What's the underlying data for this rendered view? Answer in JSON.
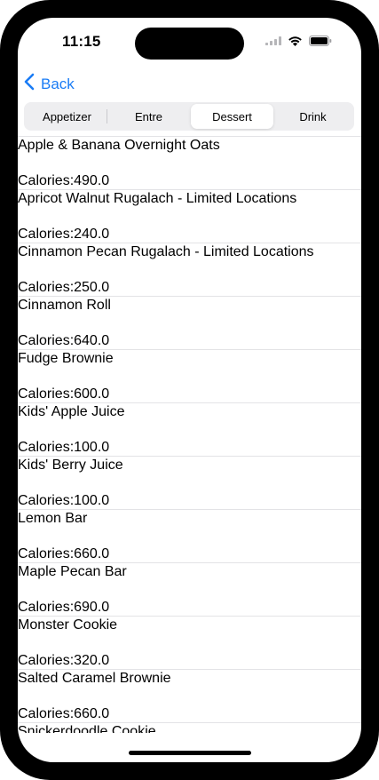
{
  "status_bar": {
    "time": "11:15",
    "signal_icon": "cellular-signal-icon",
    "wifi_icon": "wifi-icon",
    "battery_icon": "battery-icon"
  },
  "nav": {
    "back_label": "Back",
    "back_icon": "chevron-left-icon"
  },
  "segments": [
    {
      "label": "Appetizer"
    },
    {
      "label": "Entre"
    },
    {
      "label": "Dessert",
      "selected": true
    },
    {
      "label": "Drink"
    }
  ],
  "items": [
    {
      "name": "Apple & Banana Overnight Oats",
      "calories": "Calories:490.0"
    },
    {
      "name": "Apricot Walnut Rugalach - Limited Locations",
      "calories": "Calories:240.0"
    },
    {
      "name": "Cinnamon Pecan Rugalach - Limited Locations",
      "calories": "Calories:250.0"
    },
    {
      "name": "Cinnamon Roll",
      "calories": "Calories:640.0"
    },
    {
      "name": "Fudge Brownie",
      "calories": "Calories:600.0"
    },
    {
      "name": "Kids' Apple Juice",
      "calories": "Calories:100.0"
    },
    {
      "name": "Kids' Berry Juice",
      "calories": "Calories:100.0"
    },
    {
      "name": "Lemon Bar",
      "calories": "Calories:660.0"
    },
    {
      "name": "Maple Pecan Bar",
      "calories": "Calories:690.0"
    },
    {
      "name": "Monster Cookie",
      "calories": "Calories:320.0"
    },
    {
      "name": "Salted Caramel Brownie",
      "calories": "Calories:660.0"
    },
    {
      "name": "Snickerdoodle Cookie",
      "calories": ""
    }
  ],
  "colors": {
    "accent": "#1a7cf5",
    "segment_bg": "#eeeef0",
    "separator": "#e3e3e6"
  }
}
